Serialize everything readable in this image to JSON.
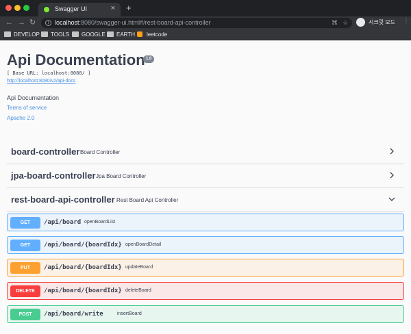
{
  "browser": {
    "tab_title": "Swagger UI",
    "tab_close": "×",
    "new_tab": "+",
    "nav": {
      "back": "←",
      "forward": "→",
      "reload": "↻"
    },
    "url_host": "localhost",
    "url_rest": ":8080/swagger-ui.html#/rest-board-api-controller",
    "profile_label": "시크릿 모드",
    "bookmarks": [
      {
        "label": "DEVELOP"
      },
      {
        "label": "TOOLS"
      },
      {
        "label": "GOOGLE"
      },
      {
        "label": "EARTH"
      },
      {
        "label": "leetcode"
      }
    ]
  },
  "info": {
    "title": "Api Documentation",
    "version": "1.0",
    "base_url": "[ Base URL: localhost:8080/ ]",
    "docs_link": "http://localhost:8080/v2/api-docs",
    "description": "Api Documentation",
    "terms_link": "Terms of service",
    "license_link": "Apache 2.0"
  },
  "tags": [
    {
      "name": "board-controller",
      "description": "Board Controller",
      "expanded": false
    },
    {
      "name": "jpa-board-controller",
      "description": "Jpa Board Controller",
      "expanded": false
    },
    {
      "name": "rest-board-api-controller",
      "description": "Rest Board Api Controller",
      "expanded": true
    }
  ],
  "operations": [
    {
      "method": "GET",
      "path": "/api/board",
      "summary": "openBoardList"
    },
    {
      "method": "GET",
      "path": "/api/board/{boardIdx}",
      "summary": "openBoardDetail"
    },
    {
      "method": "PUT",
      "path": "/api/board/{boardIdx}",
      "summary": "updateBoard"
    },
    {
      "method": "DELETE",
      "path": "/api/board/{boardIdx}",
      "summary": "deleteBoard"
    },
    {
      "method": "POST",
      "path": "/api/board/write",
      "summary": "insertBoard"
    }
  ],
  "colors": {
    "get": "#61affe",
    "put": "#fca130",
    "delete": "#f93e3e",
    "post": "#49cc90",
    "text": "#3b4151",
    "link": "#4990e2"
  }
}
